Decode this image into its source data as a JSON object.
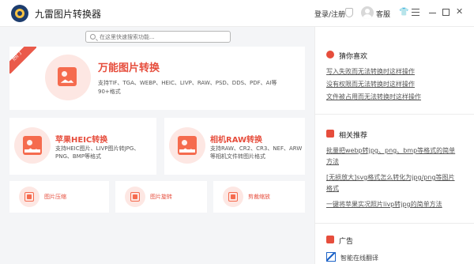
{
  "app": {
    "title": "九雷图片转换器"
  },
  "header": {
    "login_label": "登录/注册",
    "service_label": "客服"
  },
  "search": {
    "placeholder": "在这里快速搜索功能..."
  },
  "hero": {
    "badge": "热门",
    "title": "万能图片转换",
    "description": "支持TIF、TGA、WEBP、HEIC、LIVP、RAW、PSD、DDS、PDF、AI等90+格式"
  },
  "features": [
    {
      "title": "苹果HEIC转换",
      "description": "支持HEIC图片、LIVP图片转JPG、PNG、BMP等格式"
    },
    {
      "title": "相机RAW转换",
      "description": "支持RAW、CR2、CR3、NEF、ARW等相机文件转图片格式"
    }
  ],
  "tools": [
    {
      "label": "图片压缩",
      "icon": "compress-icon"
    },
    {
      "label": "图片旋转",
      "icon": "rotate-icon"
    },
    {
      "label": "剪裁缩放",
      "icon": "crop-icon"
    }
  ],
  "sidebar": {
    "like_title": "猜你喜欢",
    "like_links": [
      "写入失败而无法转换时这样操作",
      "没有权限而无法转换时这样操作",
      "文件被占用而无法转换时这样操作"
    ],
    "recommend_title": "相关推荐",
    "recommend_links": [
      "批量把webp转jpg、png、bmp等格式的简单方法",
      "[无损放大]svg格式怎么转化为jpg/png等图片格式",
      "一键将苹果实况照片livp转jpg的简单方法"
    ],
    "ad_title": "广告",
    "ad_item": "智能在线翻译"
  },
  "colors": {
    "accent": "#e64d3c",
    "light_accent": "#fde7e3",
    "background": "#f4f5f7"
  }
}
